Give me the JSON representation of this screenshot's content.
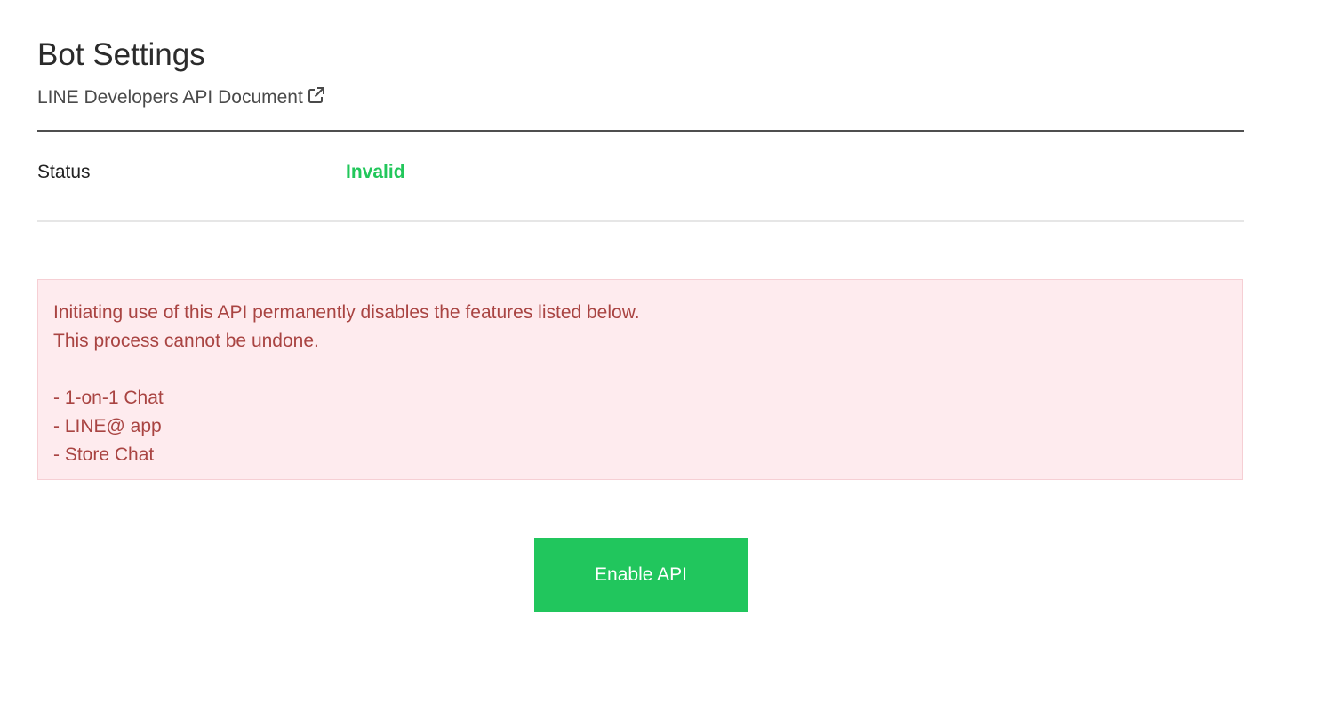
{
  "header": {
    "title": "Bot Settings",
    "doc_link_label": "LINE Developers API Document",
    "doc_link_icon": "external-link-icon"
  },
  "status": {
    "label": "Status",
    "value": "Invalid",
    "value_color": "#22c75b"
  },
  "alert": {
    "intro_lines": [
      "Initiating use of this API permanently disables the features listed below.",
      "This process cannot be undone."
    ],
    "features": [
      "- 1-on-1 Chat",
      "- LINE@ app",
      "- Store Chat"
    ],
    "background_color": "#feebee",
    "text_color": "#a94442"
  },
  "actions": {
    "enable_label": "Enable API",
    "button_color": "#21c65d"
  }
}
